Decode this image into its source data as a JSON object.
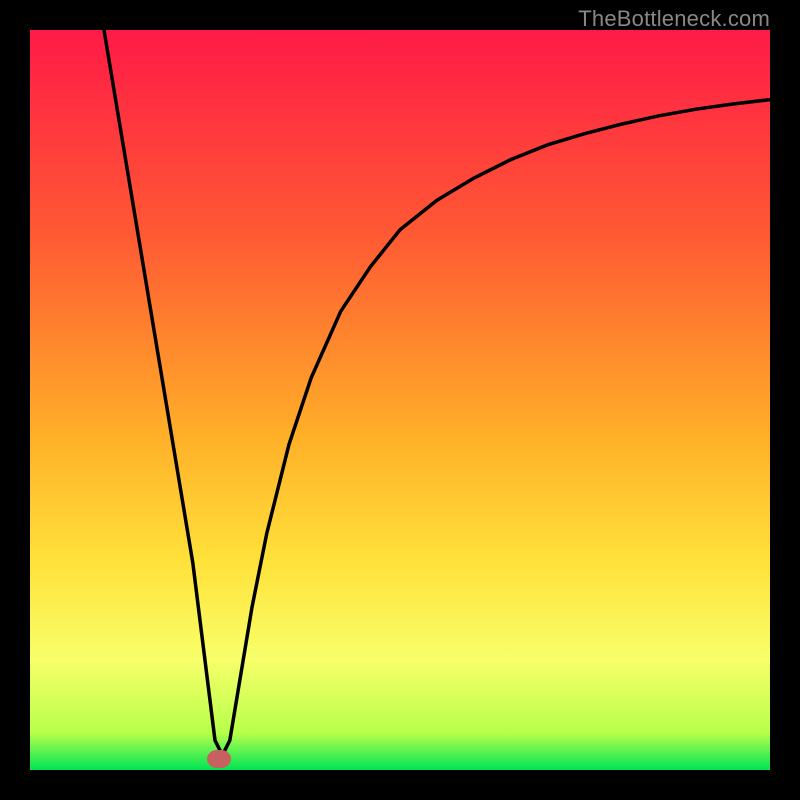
{
  "watermark": "TheBottleneck.com",
  "colors": {
    "top": "#ff1a47",
    "mid1": "#ff6a2e",
    "mid2": "#ffb028",
    "mid3": "#ffe23a",
    "mid4": "#f8ff6a",
    "bottom": "#00e455",
    "line": "#000000",
    "marker": "#c76161",
    "frame_bg": "#000000"
  },
  "chart_data": {
    "type": "line",
    "title": "",
    "xlabel": "",
    "ylabel": "",
    "xlim": [
      0,
      100
    ],
    "ylim": [
      0,
      100
    ],
    "series": [
      {
        "name": "curve",
        "x": [
          10,
          12,
          14,
          16,
          18,
          20,
          22,
          23.5,
          25,
          26,
          27,
          28,
          30,
          32,
          35,
          38,
          42,
          46,
          50,
          55,
          60,
          65,
          70,
          75,
          80,
          85,
          90,
          95,
          100
        ],
        "y": [
          100,
          88,
          76,
          64,
          52,
          40,
          28,
          16,
          4,
          2,
          4,
          10,
          22,
          32,
          44,
          53,
          62,
          68,
          73,
          77,
          80,
          82.5,
          84.5,
          86,
          87.3,
          88.4,
          89.3,
          90,
          90.6
        ]
      }
    ],
    "minimum_marker": {
      "x": 25.5,
      "y": 1.5
    },
    "gradient_stops_y_percent_from_top": [
      {
        "offset": 0,
        "color": "#ff1a47"
      },
      {
        "offset": 28,
        "color": "#ff5a33"
      },
      {
        "offset": 55,
        "color": "#ffb028"
      },
      {
        "offset": 72,
        "color": "#ffe23a"
      },
      {
        "offset": 85,
        "color": "#f8ff6a"
      },
      {
        "offset": 95,
        "color": "#b7ff4a"
      },
      {
        "offset": 100,
        "color": "#00e455"
      }
    ]
  }
}
